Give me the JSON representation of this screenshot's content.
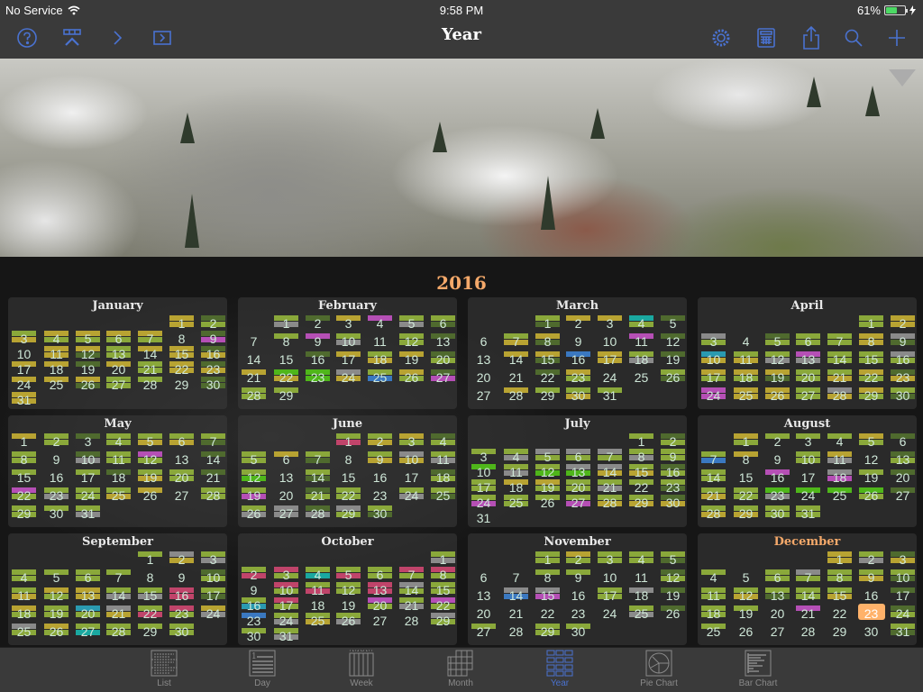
{
  "status_bar": {
    "carrier": "No Service",
    "time": "9:58 PM",
    "battery": "61%",
    "battery_level": 0.61
  },
  "nav": {
    "title": "Year",
    "left_icons": [
      "help-icon",
      "timeline-collapse-icon",
      "chevron-right-icon",
      "sidebar-toggle-icon"
    ],
    "right_icons": [
      "gear-icon",
      "calculator-icon",
      "share-icon",
      "search-icon",
      "add-icon"
    ]
  },
  "banner": {
    "collapse_icon": "triangle-down-icon"
  },
  "year": "2016",
  "colors": {
    "L": "#8aa83a",
    "D": "#4f6a2e",
    "Y": "#b8a332",
    "G": "#8a8a8a",
    "M": "#b54fb5",
    "R": "#c0446a",
    "B": "#3a78c0",
    "T": "#1aa8a0",
    "C": "#2a9ab0",
    "V": "#4fb61a",
    "accent": "#4a72d0",
    "year": "#f5a96a",
    "today": "#ffb26a"
  },
  "months": [
    {
      "name": "January",
      "start": 5,
      "days": 31,
      "bars": [
        "YY",
        "DL",
        "LY",
        "YL",
        "YL",
        "YL",
        "YL",
        "",
        "DM",
        "",
        "YY",
        "YD",
        "LL",
        "Y",
        "YY",
        "DY",
        "Y",
        "Y",
        "D",
        "Y",
        "LL",
        "YY",
        "DY",
        "Y",
        "Y",
        "YD",
        "LL",
        "L",
        "",
        "DD",
        "YY"
      ]
    },
    {
      "name": "February",
      "start": 1,
      "days": 29,
      "bars": [
        "LG",
        "D",
        "Y",
        "M",
        "LG",
        "LD",
        "",
        "L",
        "M",
        "LG",
        "",
        "LL",
        "D",
        "",
        "",
        "D",
        "Y",
        "LY",
        "Y",
        "DL",
        "Y",
        "VY",
        "VV",
        "GY",
        "LB",
        "YL",
        "DM",
        "LL",
        "L"
      ]
    },
    {
      "name": "March",
      "start": 2,
      "days": 31,
      "bars": [
        "LD",
        "Y",
        "Y",
        "TL",
        "D",
        "",
        "LY",
        "YD",
        "",
        "",
        "M",
        "D",
        "",
        "Y",
        "YD",
        "B",
        "YY",
        "LG",
        "D",
        "",
        "",
        "D",
        "YL",
        "",
        "",
        "LD",
        "",
        "Y",
        "L",
        "LY",
        "L"
      ]
    },
    {
      "name": "April",
      "start": 5,
      "days": 30,
      "bars": [
        "LL",
        "YY",
        "GL",
        "",
        "DL",
        "LL",
        "LL",
        "YY",
        "GD",
        "CY",
        "LY",
        "LG",
        "MG",
        "LL",
        "LL",
        "GL",
        "YL",
        "YL",
        "YD",
        "LL",
        "LY",
        "YL",
        "DY",
        "MM",
        "YY",
        "YY",
        "LL",
        "GY",
        "YL",
        "LD"
      ]
    },
    {
      "name": "May",
      "start": 0,
      "days": 31,
      "bars": [
        "Y",
        "LL",
        "D",
        "LL",
        "LY",
        "LY",
        "LD",
        "LL",
        "",
        "DG",
        "LL",
        "ML",
        "",
        "D",
        "L",
        "",
        "L",
        "D",
        "LY",
        "LL",
        "D",
        "ML",
        "LG",
        "LL",
        "LY",
        "Y",
        "",
        "LL",
        "LL",
        "L",
        "LG"
      ]
    },
    {
      "name": "June",
      "start": 3,
      "days": 30,
      "bars": [
        "LR",
        "LY",
        "YL",
        "DL",
        "LL",
        "Y",
        "LD",
        "",
        "LY",
        "GY",
        "LG",
        "LV",
        "",
        "LD",
        "",
        "",
        "",
        "DL",
        "LM",
        "",
        "DL",
        "LL",
        "",
        "LG",
        "LD",
        "LG",
        "GG",
        "DG",
        "GL",
        "LD"
      ]
    },
    {
      "name": "July",
      "start": 5,
      "days": 31,
      "bars": [
        "L",
        "DL",
        "L",
        "LG",
        "GL",
        "GL",
        "GL",
        "LG",
        "LL",
        "V",
        "LG",
        "LV",
        "GV",
        "GY",
        "LY",
        "DL",
        "LL",
        "Y",
        "YL",
        "LL",
        "LG",
        "L",
        "LD",
        "LM",
        "LL",
        "L",
        "LM",
        "LY",
        "LY",
        "DY",
        ""
      ]
    },
    {
      "name": "August",
      "start": 1,
      "days": 31,
      "bars": [
        "YL",
        "L",
        "L",
        "L",
        "YL",
        "D",
        "LB",
        "Y",
        "",
        "LL",
        "YG",
        "",
        "DL",
        "LL",
        "",
        "M",
        "",
        "GM",
        "L",
        "D",
        "LY",
        "LL",
        "VG",
        "V",
        "V",
        "VL",
        "D",
        "LY",
        "LY",
        "LL",
        "LL"
      ]
    },
    {
      "name": "September",
      "start": 4,
      "days": 30,
      "bars": [
        "L",
        "GY",
        "LG",
        "LL",
        "L",
        "LL",
        "L",
        "",
        "",
        "DL",
        "LY",
        "YL",
        "YY",
        "LG",
        "LG",
        "RR",
        "LD",
        "YL",
        "LL",
        "CL",
        "GY",
        "LR",
        "RL",
        "YG",
        "GL",
        "YL",
        "LT",
        "LL",
        "L",
        "LL"
      ]
    },
    {
      "name": "October",
      "start": 6,
      "days": 31,
      "bars": [
        "LG",
        "LR",
        "RL",
        "LT",
        "LR",
        "LL",
        "RL",
        "RL",
        "",
        "RL",
        "LR",
        "LL",
        "RR",
        "GL",
        "LL",
        "LC",
        "RL",
        "",
        "",
        "ML",
        "LG",
        "ML",
        "B",
        "LG",
        "LY",
        "LG",
        "",
        "",
        "GL",
        "L",
        "LG"
      ]
    },
    {
      "name": "November",
      "start": 2,
      "days": 30,
      "bars": [
        "LL",
        "YL",
        "LL",
        "LL",
        "LD",
        "",
        "",
        "L",
        "L",
        "",
        "",
        "DL",
        "",
        "GB",
        "GM",
        "",
        "LL",
        "G",
        "D",
        "",
        "",
        "",
        "",
        "",
        "LG",
        "D",
        "L",
        "",
        "LL",
        "L"
      ]
    },
    {
      "name": "December",
      "start": 4,
      "days": 31,
      "bars": [
        "YY",
        "LG",
        "DY",
        "L",
        "",
        "LL",
        "GL",
        "LL",
        "LY",
        "LD",
        "LL",
        "LY",
        "LD",
        "LL",
        "LY",
        "",
        "D",
        "LL",
        "L",
        "",
        "M",
        "",
        "",
        "DL",
        "L",
        "",
        "",
        "",
        "",
        "",
        "LD"
      ],
      "current": true,
      "today": 23
    }
  ],
  "tabs": [
    {
      "label": "List",
      "icon": "list-icon"
    },
    {
      "label": "Day",
      "icon": "day-icon"
    },
    {
      "label": "Week",
      "icon": "week-icon"
    },
    {
      "label": "Month",
      "icon": "month-icon"
    },
    {
      "label": "Year",
      "icon": "year-icon",
      "active": true
    },
    {
      "label": "Pie Chart",
      "icon": "pie-chart-icon"
    },
    {
      "label": "Bar Chart",
      "icon": "bar-chart-icon"
    }
  ]
}
